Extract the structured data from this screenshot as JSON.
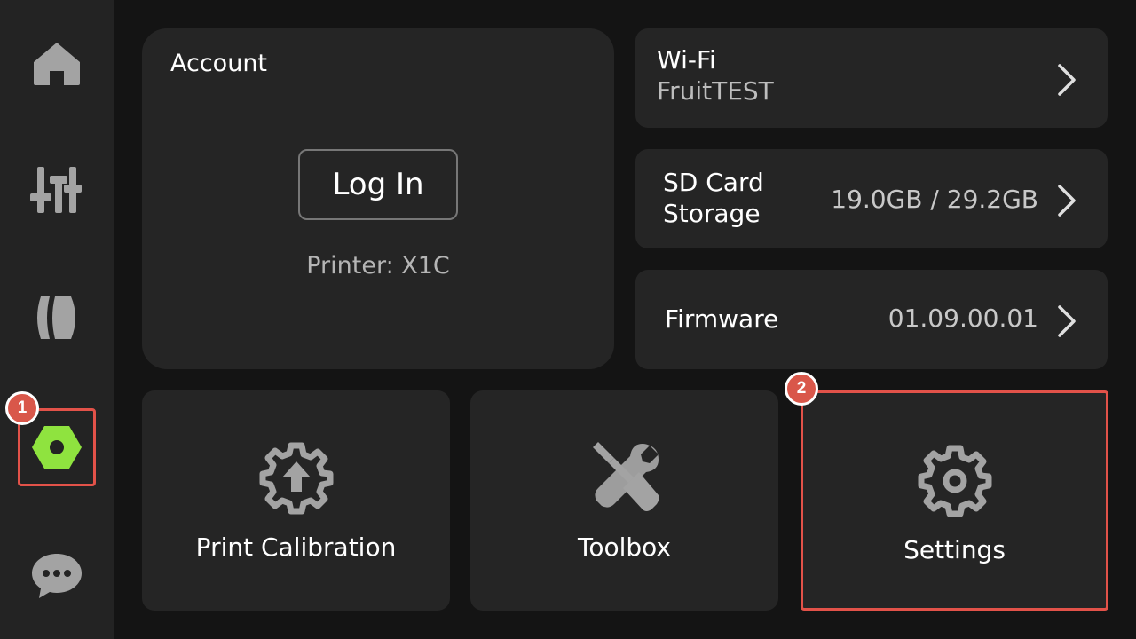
{
  "sidebar": {
    "items": [
      {
        "icon": "home-icon"
      },
      {
        "icon": "controls-sliders-icon"
      },
      {
        "icon": "filament-spool-icon"
      },
      {
        "icon": "hex-nut-settings-icon",
        "active": true,
        "active_color": "#8fe33f"
      },
      {
        "icon": "chat-bubble-icon"
      }
    ]
  },
  "annotations": {
    "step1": "1",
    "step2": "2",
    "highlight_color": "#e25249"
  },
  "account": {
    "title": "Account",
    "login_label": "Log In",
    "printer_label": "Printer: X1C"
  },
  "wifi": {
    "title": "Wi-Fi",
    "network": "FruitTEST"
  },
  "sd_card": {
    "title_line1": "SD Card",
    "title_line2": "Storage",
    "value": "19.0GB / 29.2GB"
  },
  "firmware": {
    "title": "Firmware",
    "value": "01.09.00.01"
  },
  "tiles": [
    {
      "label": "Print Calibration",
      "icon": "gear-upload-icon"
    },
    {
      "label": "Toolbox",
      "icon": "wrench-screwdriver-icon"
    },
    {
      "label": "Settings",
      "icon": "gear-icon"
    }
  ]
}
